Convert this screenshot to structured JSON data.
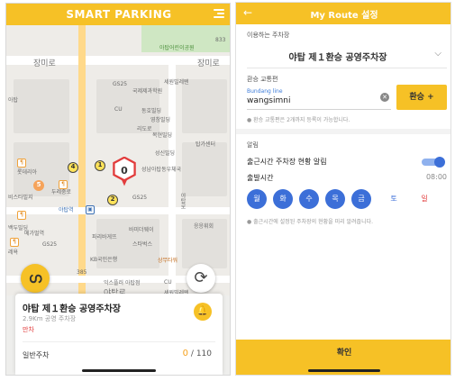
{
  "left_screen": {
    "app_title": "SMART PARKING",
    "map": {
      "labels": {
        "jangmiro_1": "장미로",
        "jangmiro_2": "장미로",
        "num_833": "833",
        "kinder": "아탑어린이공원",
        "gs25_1": "GS25",
        "gs25_2": "GS25",
        "gs25_3": "GS25",
        "cu_1": "CU",
        "cu_2": "CU",
        "cu_3": "CU",
        "semil": "세원빌레텐",
        "global_school": "국제제과학원",
        "dongbo": "동호빌딩",
        "yeonghyeon": "영창빌딩",
        "lido": "리도로",
        "bongmi": "복현빌딩",
        "tap_center": "탑가센터",
        "seongshin": "성신빌딩",
        "seongnam_post": "성남아탑동우체국",
        "doduri": "두레중로",
        "yatap_station": "야탑역",
        "mega": "메가벌역",
        "paris": "파리바게뜨",
        "starbucks": "스타벅스",
        "bank": "바미더웨이",
        "kb": "KB국민은행",
        "sangmun": "상무타워",
        "yatap_ro": "야탑로",
        "yatap_ro_v": "야탑로",
        "city_hall": "응응휘회",
        "mix_build": "익스플러 아탑점",
        "semil_cafe": "세원빌레텐",
        "bus_385": "385",
        "alpha": "롯데리아",
        "visit": "비스타빌지",
        "baekdu": "백두빌딩",
        "heyo": "레욕",
        "num_609": "609동",
        "num_304": "304동",
        "yatap_kr": "아탑"
      },
      "main_pin_count": "0",
      "marker_1": "1",
      "marker_2": "2",
      "marker_4": "4",
      "marker_5": "5",
      "logo_icon_glyph": "ഗ",
      "refresh_glyph": "⟳"
    },
    "card": {
      "name": "야탑 제１환승 공영주차장",
      "distance": "2.9Km 공영 주차장",
      "status": "만차",
      "parking_type": "일반주차",
      "available": "0",
      "capacity": "/ 110",
      "bell_glyph": "🔔"
    }
  },
  "right_screen": {
    "title": "My Route 설정",
    "back_glyph": "←",
    "lot_section_label": "이용하는 주차장",
    "lot_value": "야탑 제１환승 공영주차장",
    "chevron": "⌵",
    "transfer_section_label": "환승 교통편",
    "line_placeholder": "Bundang line",
    "line_value": "wangsimni",
    "clear_glyph": "✕",
    "transfer_button": "환승 +",
    "transfer_note": "● 환승 교통편은 2개까지 등록이 가능합니다.",
    "alert_section_label": "알림",
    "alert_label": "출근시간 주차장 현황 알림",
    "alert_on": true,
    "time_label": "출발시간",
    "time_value": "08:00",
    "days": [
      {
        "label": "월",
        "selected": true
      },
      {
        "label": "화",
        "selected": true
      },
      {
        "label": "수",
        "selected": true
      },
      {
        "label": "목",
        "selected": true
      },
      {
        "label": "금",
        "selected": true
      },
      {
        "label": "토",
        "selected": false
      },
      {
        "label": "일",
        "selected": false
      }
    ],
    "days_note": "● 출근시간에 설정된 주차장의 현황을 미리 알려줍니다.",
    "confirm_button": "확인"
  },
  "colors": {
    "brand_yellow": "#f6c126",
    "accent_blue": "#3c6fd8",
    "alert_red": "#e23c3c",
    "count_orange": "#f6a21e"
  }
}
